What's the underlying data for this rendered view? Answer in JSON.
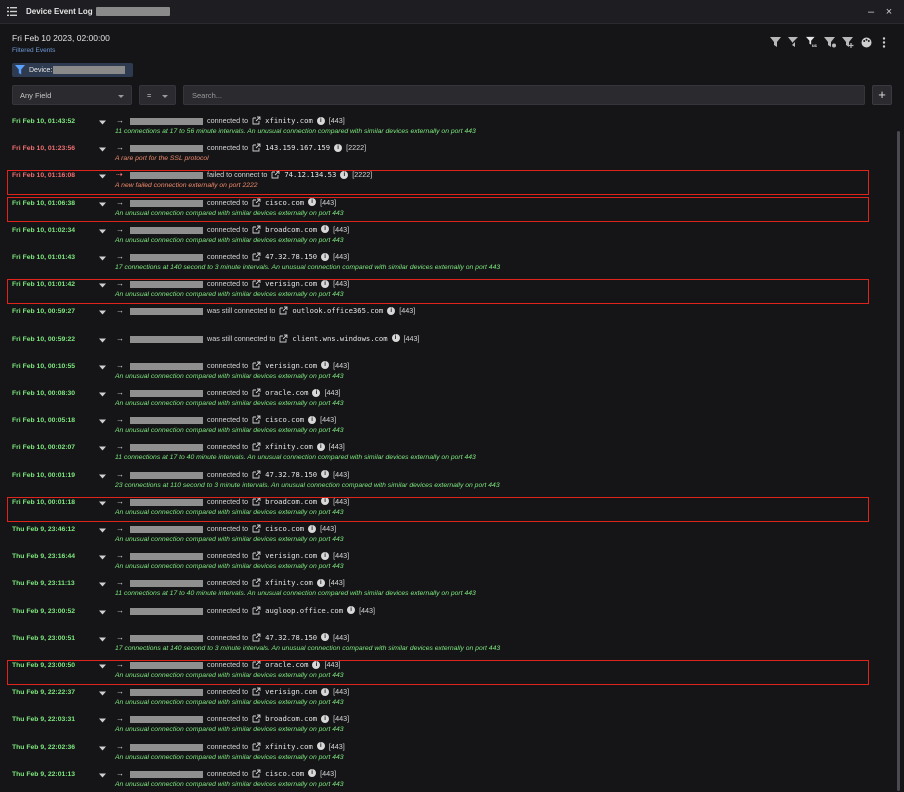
{
  "window": {
    "title": "Device Event Log"
  },
  "header": {
    "date": "Fri Feb 10 2023, 02:00:00",
    "subtitle": "Filtered Events"
  },
  "filter_chip": {
    "label": "Device:"
  },
  "filterbar": {
    "field": "Any Field",
    "operator": "=",
    "search_placeholder": "Search...",
    "add_label": "+"
  },
  "events": [
    {
      "ts": "Fri Feb 10, 01:43:52",
      "verb": "connected to",
      "host": "xfinity.com",
      "port": "[443]",
      "desc": "11 connections at 17 to 56 minute intervals. An unusual connection compared with similar devices externally on port 443",
      "alert": false
    },
    {
      "ts": "Fri Feb 10, 01:23:56",
      "verb": "connected to",
      "host": "143.159.167.159",
      "port": "[2222]",
      "desc": "A rare port for the SSL protocol",
      "alert": true
    },
    {
      "ts": "Fri Feb 10, 01:16:08",
      "verb": "failed to connect to",
      "host": "74.12.134.53",
      "port": "[2222]",
      "desc": "A new failed connection externally on port 2222",
      "alert": true,
      "failed": true
    },
    {
      "ts": "Fri Feb 10, 01:06:38",
      "verb": "connected to",
      "host": "cisco.com",
      "port": "[443]",
      "desc": "An unusual connection compared with similar devices externally on port 443",
      "alert": false
    },
    {
      "ts": "Fri Feb 10, 01:02:34",
      "verb": "connected to",
      "host": "broadcom.com",
      "port": "[443]",
      "desc": "An unusual connection compared with similar devices externally on port 443",
      "alert": false
    },
    {
      "ts": "Fri Feb 10, 01:01:43",
      "verb": "connected to",
      "host": "47.32.78.150",
      "port": "[443]",
      "desc": "17 connections at 140 second to 3 minute intervals. An unusual connection compared with similar devices externally on port 443",
      "alert": false
    },
    {
      "ts": "Fri Feb 10, 01:01:42",
      "verb": "connected to",
      "host": "verisign.com",
      "port": "[443]",
      "desc": "An unusual connection compared with similar devices externally on port 443",
      "alert": false
    },
    {
      "ts": "Fri Feb 10, 00:59:27",
      "verb": "was still connected to",
      "host": "outlook.office365.com",
      "port": "[443]",
      "desc": "",
      "alert": false
    },
    {
      "ts": "Fri Feb 10, 00:59:22",
      "verb": "was still connected to",
      "host": "client.wns.windows.com",
      "port": "[443]",
      "desc": "",
      "alert": false
    },
    {
      "ts": "Fri Feb 10, 00:10:55",
      "verb": "connected to",
      "host": "verisign.com",
      "port": "[443]",
      "desc": "An unusual connection compared with similar devices externally on port 443",
      "alert": false
    },
    {
      "ts": "Fri Feb 10, 00:08:30",
      "verb": "connected to",
      "host": "oracle.com",
      "port": "[443]",
      "desc": "An unusual connection compared with similar devices externally on port 443",
      "alert": false
    },
    {
      "ts": "Fri Feb 10, 00:05:18",
      "verb": "connected to",
      "host": "cisco.com",
      "port": "[443]",
      "desc": "An unusual connection compared with similar devices externally on port 443",
      "alert": false
    },
    {
      "ts": "Fri Feb 10, 00:02:07",
      "verb": "connected to",
      "host": "xfinity.com",
      "port": "[443]",
      "desc": "11 connections at 17 to 40 minute intervals. An unusual connection compared with similar devices externally on port 443",
      "alert": false
    },
    {
      "ts": "Fri Feb 10, 00:01:19",
      "verb": "connected to",
      "host": "47.32.78.150",
      "port": "[443]",
      "desc": "23 connections at 110 second to 3 minute intervals. An unusual connection compared with similar devices externally on port 443",
      "alert": false
    },
    {
      "ts": "Fri Feb 10, 00:01:18",
      "verb": "connected to",
      "host": "broadcom.com",
      "port": "[443]",
      "desc": "An unusual connection compared with similar devices externally on port 443",
      "alert": false
    },
    {
      "ts": "Thu Feb 9, 23:46:12",
      "verb": "connected to",
      "host": "cisco.com",
      "port": "[443]",
      "desc": "An unusual connection compared with similar devices externally on port 443",
      "alert": false
    },
    {
      "ts": "Thu Feb 9, 23:16:44",
      "verb": "connected to",
      "host": "verisign.com",
      "port": "[443]",
      "desc": "An unusual connection compared with similar devices externally on port 443",
      "alert": false
    },
    {
      "ts": "Thu Feb 9, 23:11:13",
      "verb": "connected to",
      "host": "xfinity.com",
      "port": "[443]",
      "desc": "11 connections at 17 to 40 minute intervals. An unusual connection compared with similar devices externally on port 443",
      "alert": false
    },
    {
      "ts": "Thu Feb 9, 23:00:52",
      "verb": "connected to",
      "host": "augloop.office.com",
      "port": "[443]",
      "desc": "",
      "alert": false
    },
    {
      "ts": "Thu Feb 9, 23:00:51",
      "verb": "connected to",
      "host": "47.32.78.150",
      "port": "[443]",
      "desc": "17 connections at 140 second to 3 minute intervals. An unusual connection compared with similar devices externally on port 443",
      "alert": false
    },
    {
      "ts": "Thu Feb 9, 23:00:50",
      "verb": "connected to",
      "host": "oracle.com",
      "port": "[443]",
      "desc": "An unusual connection compared with similar devices externally on port 443",
      "alert": false
    },
    {
      "ts": "Thu Feb 9, 22:22:37",
      "verb": "connected to",
      "host": "verisign.com",
      "port": "[443]",
      "desc": "An unusual connection compared with similar devices externally on port 443",
      "alert": false
    },
    {
      "ts": "Thu Feb 9, 22:03:31",
      "verb": "connected to",
      "host": "broadcom.com",
      "port": "[443]",
      "desc": "An unusual connection compared with similar devices externally on port 443",
      "alert": false
    },
    {
      "ts": "Thu Feb 9, 22:02:36",
      "verb": "connected to",
      "host": "xfinity.com",
      "port": "[443]",
      "desc": "An unusual connection compared with similar devices externally on port 443",
      "alert": false
    },
    {
      "ts": "Thu Feb 9, 22:01:13",
      "verb": "connected to",
      "host": "cisco.com",
      "port": "[443]",
      "desc": "An unusual connection compared with similar devices externally on port 443",
      "alert": false
    }
  ],
  "highlighted_rows": [
    1,
    2,
    5,
    13,
    19
  ],
  "colors": {
    "normal_text": "#7ee87e",
    "alert_text": "#f07070",
    "highlight_border": "#e0231b"
  }
}
